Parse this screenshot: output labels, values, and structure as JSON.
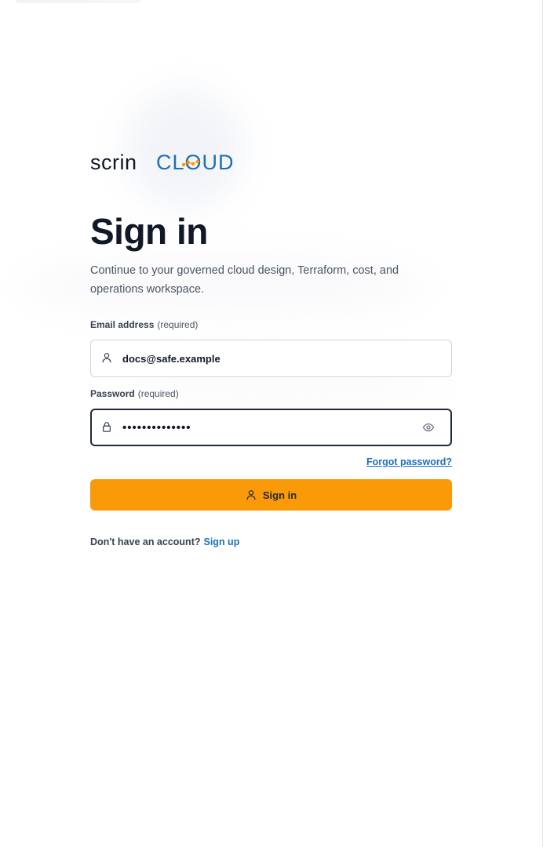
{
  "brand": {
    "logo_text_dark": "scrin",
    "logo_text_blue": "CLOUD",
    "dark_color": "#111827",
    "blue_color": "#1d6fb8",
    "accent_color": "#fb9a08"
  },
  "page": {
    "title": "Sign in",
    "subtitle": "Continue to your governed cloud design, Terraform, cost, and operations workspace."
  },
  "form": {
    "email": {
      "label": "Email address",
      "required_text": "(required)",
      "value": "docs@safe.example",
      "icon": "user-icon"
    },
    "password": {
      "label": "Password",
      "required_text": "(required)",
      "value": "••••••••••••••",
      "icon": "lock-icon",
      "toggle_icon": "eye-icon"
    },
    "forgot_label": "Forgot password?",
    "submit_label": "Sign in",
    "submit_icon": "user-icon"
  },
  "footer": {
    "question": "Don't have an account?",
    "signup_label": "Sign up"
  }
}
